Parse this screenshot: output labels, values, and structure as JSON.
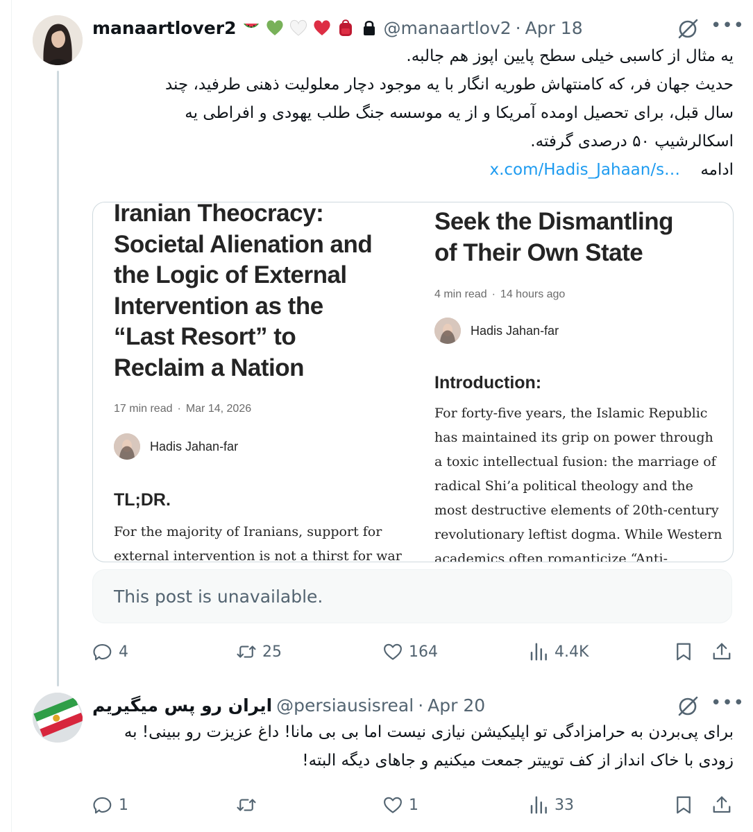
{
  "tweet1": {
    "display_name": "manaartlover2",
    "handle": "@manaartlov2",
    "separator": "·",
    "date": "Apr 18",
    "text_lines": [
      "یه مثال از کاسبی خیلی سطح پایین اپوز هم جالبه.",
      "حدیث جهان فر، که کامنتهاش طوریه انگار با یه موجود دچار معلولیت ذهنی طرفید، چند",
      "سال قبل، برای تحصیل اومده آمریکا و از یه موسسه جنگ طلب یهودی و افراطی یه",
      "اسکالرشیپ ۵۰ درصدی گرفته."
    ],
    "more_label": "ادامه",
    "link_text": "x.com/Hadis_Jahaan/s…",
    "media": {
      "left_article": {
        "title_lines": [
          "Iranian Theocracy:",
          "Societal Alienation and",
          "the Logic of External",
          "Intervention as the",
          "“Last Resort” to",
          "Reclaim a Nation"
        ],
        "read_time": "17 min read",
        "dot": "·",
        "date": "Mar 14, 2026",
        "author": "Hadis Jahan-far",
        "section": "TL;DR.",
        "body_lines": [
          "For the majority of Iranians, support for",
          "external intervention is not a thirst for war"
        ]
      },
      "right_article": {
        "title_lines": [
          "Seek the Dismantling",
          "of Their Own State"
        ],
        "read_time": "4 min read",
        "dot": "·",
        "date": "14 hours ago",
        "author": "Hadis Jahan-far",
        "section": "Introduction:",
        "body_lines": [
          "For forty-five years, the Islamic Republic",
          "has maintained its grip on power through",
          "a toxic intellectual fusion: the marriage of",
          "radical Shi’a political theology and the",
          "most destructive elements of 20th-century",
          "revolutionary leftist dogma. While Western",
          "academics often romanticize “Anti-"
        ]
      }
    },
    "quote_unavailable": "This post is unavailable.",
    "stats": {
      "replies": "4",
      "reposts": "25",
      "likes": "164",
      "views": "4.4K"
    }
  },
  "tweet2": {
    "display_name": "ایران رو پس میگیریم",
    "handle": "@persiausisreal",
    "separator": "·",
    "date": "Apr 20",
    "text_lines": [
      "برای پی‌بردن به حرامزادگی تو اپلیکیشن نیازی نیست اما بی بی مانا! داغ عزیزت رو ببینی! به",
      "زودی با خاک انداز از کف توییتر جمعت میکنیم و جاهای دیگه البته!"
    ],
    "stats": {
      "replies": "1",
      "reposts": "",
      "likes": "1",
      "views": "33"
    }
  },
  "icons": {
    "reply": "reply-icon",
    "repost": "repost-icon",
    "like": "like-icon",
    "views": "views-icon",
    "bookmark": "bookmark-icon",
    "share": "share-icon",
    "grok": "grok-icon",
    "more": "more-icon",
    "lock": "lock-icon"
  },
  "colors": {
    "link": "#1d9bf0",
    "muted": "#536471",
    "thread_line": "#cfd9de"
  }
}
